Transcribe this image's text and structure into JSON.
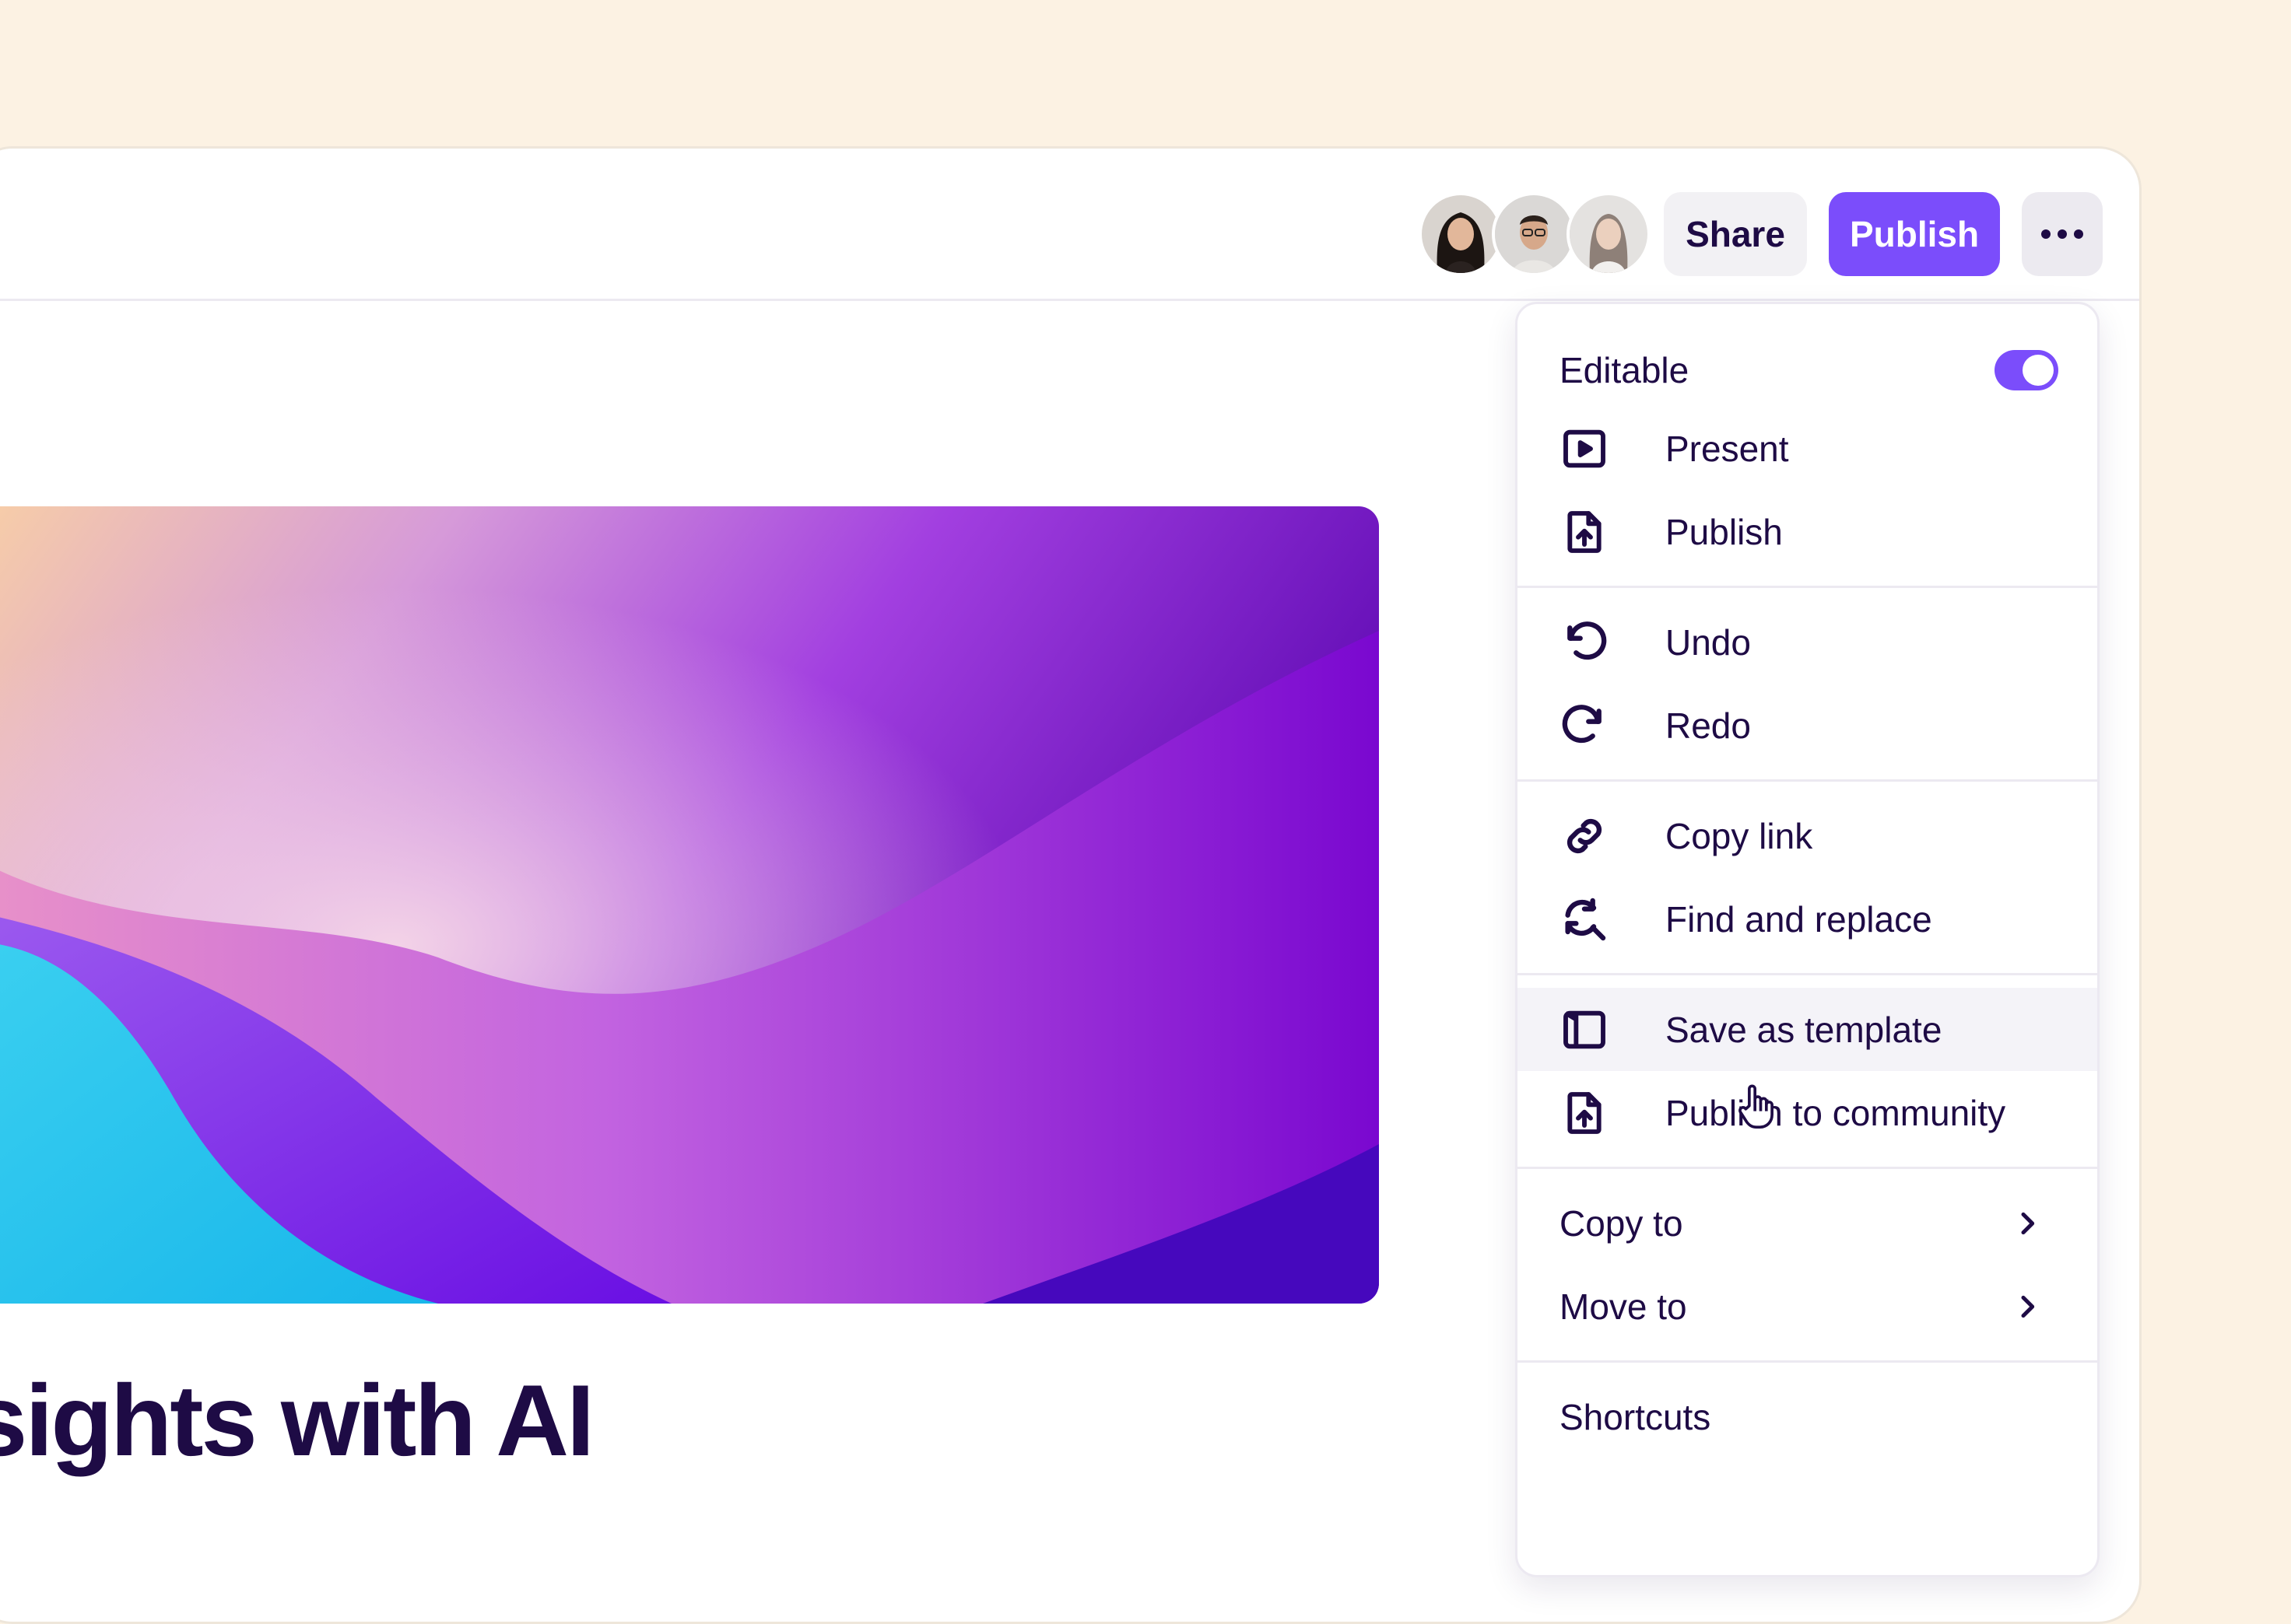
{
  "header": {
    "share_label": "Share",
    "publish_label": "Publish",
    "more_icon": "more-horizontal-icon",
    "collaborators": [
      {
        "name": "avatar-woman-dark-hair"
      },
      {
        "name": "avatar-man-glasses"
      },
      {
        "name": "avatar-woman-light"
      }
    ]
  },
  "document": {
    "title": "sights with AI"
  },
  "menu": {
    "editable_label": "Editable",
    "editable_on": true,
    "sections": [
      [
        {
          "label": "Present",
          "icon": "present-icon"
        },
        {
          "label": "Publish",
          "icon": "publish-icon"
        }
      ],
      [
        {
          "label": "Undo",
          "icon": "undo-icon"
        },
        {
          "label": "Redo",
          "icon": "redo-icon"
        }
      ],
      [
        {
          "label": "Copy link",
          "icon": "link-icon"
        },
        {
          "label": "Find and replace",
          "icon": "find-replace-icon"
        }
      ],
      [
        {
          "label": "Save as template",
          "icon": "template-icon"
        },
        {
          "label": "Publish to community",
          "icon": "publish-community-icon"
        }
      ]
    ],
    "copy_to_label": "Copy to",
    "move_to_label": "Move to",
    "shortcuts_label": "Shortcuts"
  },
  "colors": {
    "accent": "#7B4DFB",
    "text": "#1E0B45",
    "background": "#FCF2E3"
  }
}
